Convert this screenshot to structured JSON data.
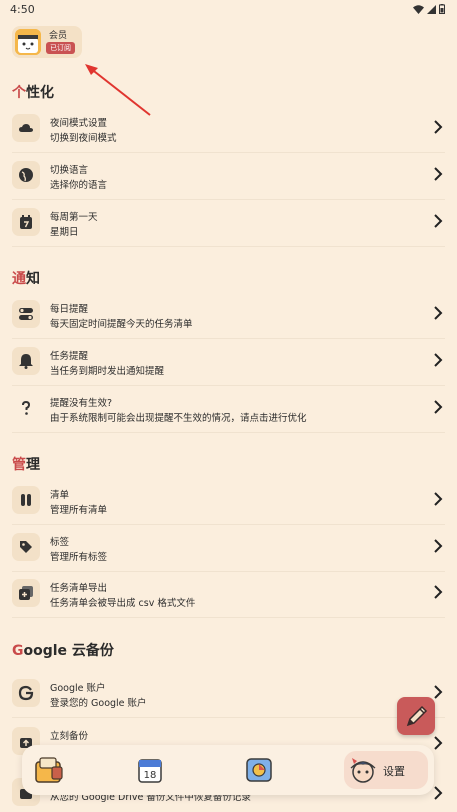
{
  "status": {
    "time": "4:50"
  },
  "member": {
    "label": "会员",
    "badge": "已订阅"
  },
  "sections": {
    "personalize": {
      "first": "个",
      "rest": "性化"
    },
    "notify": {
      "first": "通",
      "rest": "知"
    },
    "manage": {
      "first": "管",
      "rest": "理"
    },
    "backup": {
      "first": "G",
      "rest": "oogle 云备份"
    }
  },
  "rows": {
    "night": {
      "title": "夜间模式设置",
      "subtitle": "切换到夜间模式"
    },
    "language": {
      "title": "切换语言",
      "subtitle": "选择你的语言"
    },
    "week": {
      "title": "每周第一天",
      "subtitle": "星期日"
    },
    "daily": {
      "title": "每日提醒",
      "subtitle": "每天固定时间提醒今天的任务清单"
    },
    "task": {
      "title": "任务提醒",
      "subtitle": "当任务到期时发出通知提醒"
    },
    "noeffect": {
      "title": "提醒没有生效?",
      "subtitle": "由于系统限制可能会出现提醒不生效的情况，请点击进行优化"
    },
    "lists": {
      "title": "清单",
      "subtitle": "管理所有清单"
    },
    "tags": {
      "title": "标签",
      "subtitle": "管理所有标签"
    },
    "export": {
      "title": "任务清单导出",
      "subtitle": "任务清单会被导出成 csv 格式文件"
    },
    "account": {
      "title": "Google 账户",
      "subtitle": "登录您的 Google 账户"
    },
    "backupnow": {
      "title": "立刻备份",
      "subtitle": ""
    },
    "restore": {
      "title": "",
      "subtitle": "从您的 Google Drive 备份文件中恢复备份记录"
    }
  },
  "nav": {
    "settings_label": "设置"
  },
  "colors": {
    "background": "#fbeedd",
    "accent": "#c94a4a"
  }
}
